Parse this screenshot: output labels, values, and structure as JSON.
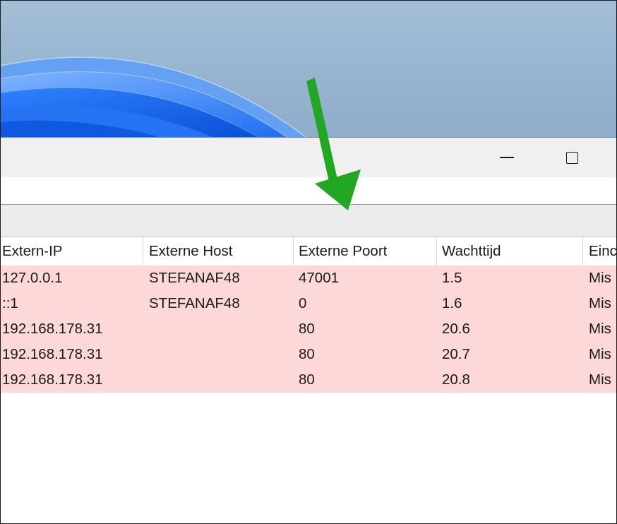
{
  "colors": {
    "arrow": "#22a722",
    "row_highlight": "#fdd8d8",
    "wallpaper": "#95b3cf",
    "bloom": "#1a5fe0"
  },
  "icons": {
    "minimize": "minimize-icon",
    "maximize": "maximize-icon",
    "annotation_arrow": "green-arrow-icon"
  },
  "table": {
    "columns": [
      "Extern-IP",
      "Externe Host",
      "Externe Poort",
      "Wachttijd",
      "Einc"
    ],
    "rows": [
      [
        "127.0.0.1",
        "STEFANAF48",
        "47001",
        "1.5",
        "Mis"
      ],
      [
        "::1",
        "STEFANAF48",
        "0",
        "1.6",
        "Mis"
      ],
      [
        "192.168.178.31",
        "",
        "80",
        "20.6",
        "Mis"
      ],
      [
        "192.168.178.31",
        "",
        "80",
        "20.7",
        "Mis"
      ],
      [
        "192.168.178.31",
        "",
        "80",
        "20.8",
        "Mis"
      ]
    ]
  }
}
